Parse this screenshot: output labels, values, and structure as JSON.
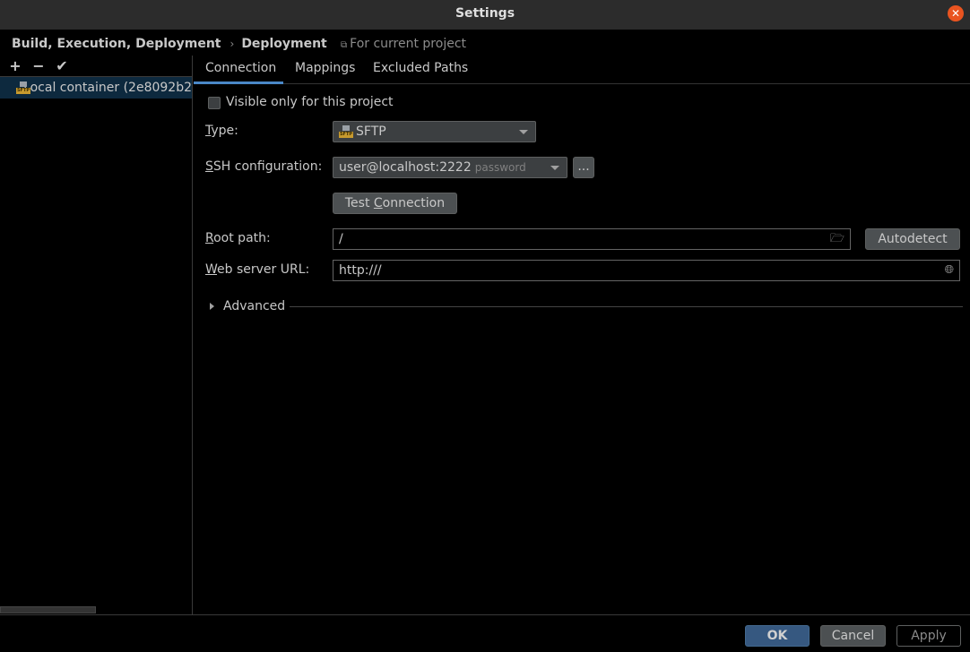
{
  "window": {
    "title": "Settings",
    "close_icon": "close-icon"
  },
  "breadcrumb": {
    "parent": "Build, Execution, Deployment",
    "separator": "›",
    "current": "Deployment",
    "scope_icon": "copy-icon",
    "scope": "For current project"
  },
  "sidebar": {
    "toolbar": {
      "add": "+",
      "remove": "−",
      "apply": "✔"
    },
    "items": [
      {
        "label": "Local container (2e8092b2",
        "icon": "sftp-icon",
        "icon_text": "SFTP",
        "selected": true
      }
    ]
  },
  "tabs": [
    {
      "label": "Connection",
      "active": true
    },
    {
      "label": "Mappings",
      "active": false
    },
    {
      "label": "Excluded Paths",
      "active": false
    }
  ],
  "form": {
    "visible_only_label": "Visible only for this project",
    "visible_only_checked": false,
    "type_label_mn": "T",
    "type_label_rest": "ype:",
    "type_value": "SFTP",
    "ssh_label_mn": "S",
    "ssh_label_rest": "SH configuration:",
    "ssh_value": "user@localhost:2222",
    "ssh_hint": "password",
    "ssh_more": "...",
    "test_pre": "Test ",
    "test_mn": "C",
    "test_post": "onnection",
    "root_label_mn": "R",
    "root_label_rest": "oot path:",
    "root_value": "/",
    "autodetect": "Autodetect",
    "web_label_mn": "W",
    "web_label_rest": "eb server URL:",
    "web_value": "http:///",
    "advanced": "Advanced"
  },
  "footer": {
    "ok": "OK",
    "cancel": "Cancel",
    "apply": "Apply"
  },
  "colors": {
    "accent": "#4a88c7",
    "ok_button": "#365880",
    "close": "#e95420",
    "selection": "#0d293e"
  }
}
